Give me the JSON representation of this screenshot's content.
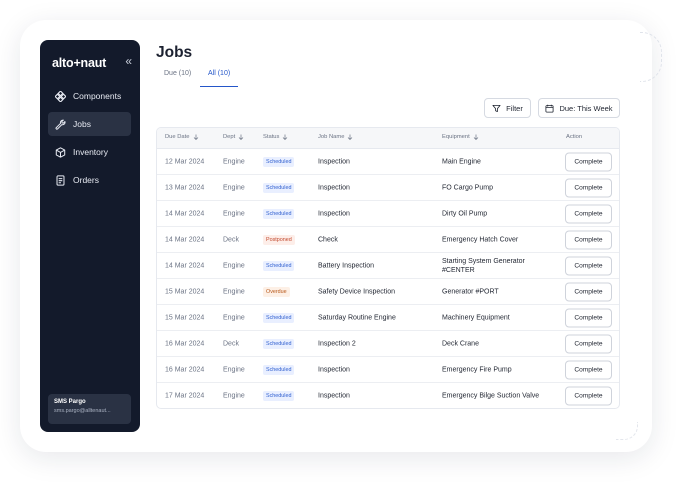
{
  "app": {
    "logo_left": "alto",
    "logo_plus": "+",
    "logo_right": "naut",
    "collapse_glyph": "«"
  },
  "sidebar": {
    "items": [
      {
        "label": "Components",
        "icon": "components-icon",
        "active": false
      },
      {
        "label": "Jobs",
        "icon": "wrench-icon",
        "active": true
      },
      {
        "label": "Inventory",
        "icon": "cube-icon",
        "active": false
      },
      {
        "label": "Orders",
        "icon": "clipboard-icon",
        "active": false
      }
    ],
    "user": {
      "name": "SMS Pargo",
      "email": "sms.pargo@alltenaut..."
    }
  },
  "page": {
    "title": "Jobs",
    "tabs": [
      {
        "label": "Due (10)",
        "active": false
      },
      {
        "label": "All (10)",
        "active": true
      }
    ]
  },
  "toolbar": {
    "filter_label": "Filter",
    "due_label": "Due: This Week"
  },
  "table": {
    "headers": {
      "due_date": "Due Date",
      "dept": "Dept",
      "status": "Status",
      "job_name": "Job Name",
      "equipment": "Equipment",
      "action": "Action"
    },
    "action_label": "Complete",
    "rows": [
      {
        "due": "12 Mar 2024",
        "dept": "Engine",
        "status": "Scheduled",
        "job": "Inspection",
        "equipment": "Main Engine"
      },
      {
        "due": "13 Mar 2024",
        "dept": "Engine",
        "status": "Scheduled",
        "job": "Inspection",
        "equipment": "FO Cargo Pump"
      },
      {
        "due": "14 Mar 2024",
        "dept": "Engine",
        "status": "Scheduled",
        "job": "Inspection",
        "equipment": "Dirty Oil Pump"
      },
      {
        "due": "14 Mar 2024",
        "dept": "Deck",
        "status": "Postponed",
        "job": "Check",
        "equipment": "Emergency Hatch Cover"
      },
      {
        "due": "14 Mar 2024",
        "dept": "Engine",
        "status": "Scheduled",
        "job": "Battery Inspection",
        "equipment": "Starting System Generator #CENTER"
      },
      {
        "due": "15 Mar 2024",
        "dept": "Engine",
        "status": "Overdue",
        "job": "Safety Device Inspection",
        "equipment": "Generator #PORT"
      },
      {
        "due": "15 Mar 2024",
        "dept": "Engine",
        "status": "Scheduled",
        "job": "Saturday Routine Engine",
        "equipment": "Machinery Equipment"
      },
      {
        "due": "16 Mar 2024",
        "dept": "Deck",
        "status": "Scheduled",
        "job": "Inspection 2",
        "equipment": "Deck Crane"
      },
      {
        "due": "16 Mar 2024",
        "dept": "Engine",
        "status": "Scheduled",
        "job": "Inspection",
        "equipment": "Emergency Fire Pump"
      },
      {
        "due": "17 Mar 2024",
        "dept": "Engine",
        "status": "Scheduled",
        "job": "Inspection",
        "equipment": "Emergency Bilge Suction Valve"
      }
    ]
  },
  "colors": {
    "sidebar_bg": "#131a2b",
    "accent": "#2456c9",
    "scheduled_text": "#2f5fd0",
    "scheduled_bg": "#e9efff",
    "postponed_text": "#c2492e",
    "postponed_bg": "#fdeee9",
    "overdue_text": "#b8581a",
    "overdue_bg": "#fdf0e6"
  }
}
